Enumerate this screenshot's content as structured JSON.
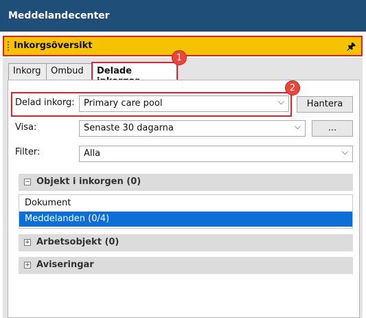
{
  "window": {
    "title": "Meddelandecenter"
  },
  "panel": {
    "title": "Inkorgsöversikt",
    "pin_icon": "pin-icon"
  },
  "tabs": [
    {
      "label": "Inkorg"
    },
    {
      "label": "Ombud"
    },
    {
      "label": "Delade inkorgar"
    }
  ],
  "markers": {
    "one": "1",
    "two": "2"
  },
  "form": {
    "shared_inbox": {
      "label": "Delad inkorg:",
      "value": "Primary care pool",
      "button": "Hantera"
    },
    "show": {
      "label": "Visa:",
      "value": "Senaste 30 dagarna",
      "button": "..."
    },
    "filter": {
      "label": "Filter:",
      "value": "Alla"
    }
  },
  "sections": {
    "inbox_items": {
      "title": "Objekt i inkorgen (0)",
      "expanded": true
    },
    "work_items": {
      "title": "Arbetsobjekt (0)",
      "expanded": false
    },
    "notifications": {
      "title": "Aviseringar",
      "expanded": false
    }
  },
  "list": [
    {
      "label": "Dokument",
      "selected": false
    },
    {
      "label": "Meddelanden (0/4)",
      "selected": true
    }
  ],
  "colors": {
    "titlebar": "#1f4e79",
    "panelbar": "#f5c200",
    "highlight": "#e0202a",
    "selection": "#0d6ed7"
  }
}
